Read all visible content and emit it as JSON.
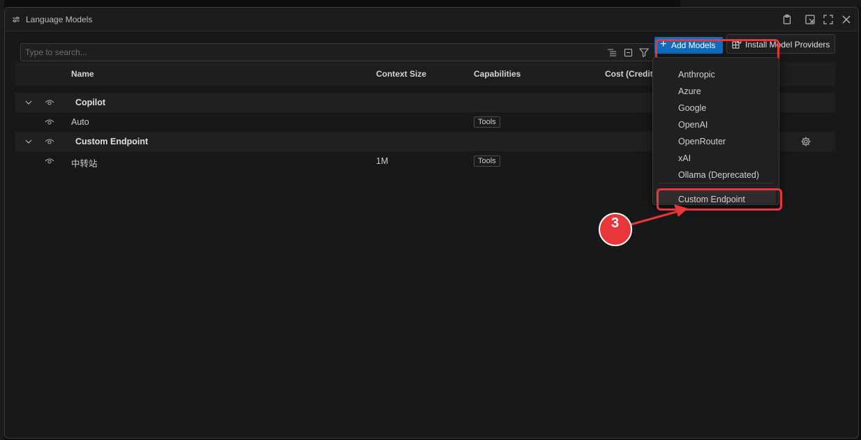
{
  "window": {
    "title": "Language Models"
  },
  "search": {
    "placeholder": "Type to search..."
  },
  "toolbar": {
    "add_models": "Add Models",
    "install_providers": "Install Model Providers"
  },
  "table": {
    "columns": [
      "Name",
      "Context Size",
      "Capabilities",
      "Cost (Credits"
    ],
    "groups": [
      {
        "name": "Copilot",
        "models": [
          {
            "name": "Auto",
            "context": "",
            "capability": "Tools"
          }
        ]
      },
      {
        "name": "Custom Endpoint",
        "models": [
          {
            "name": "中转站",
            "context": "1M",
            "capability": "Tools"
          }
        ]
      }
    ]
  },
  "menu": {
    "items": [
      "Anthropic",
      "Azure",
      "Google",
      "OpenAI",
      "OpenRouter",
      "xAI",
      "Ollama (Deprecated)"
    ],
    "custom": "Custom Endpoint"
  },
  "annotation": {
    "step": "3"
  },
  "colors": {
    "accent": "#0f6cbd",
    "highlight": "#e8363a"
  }
}
